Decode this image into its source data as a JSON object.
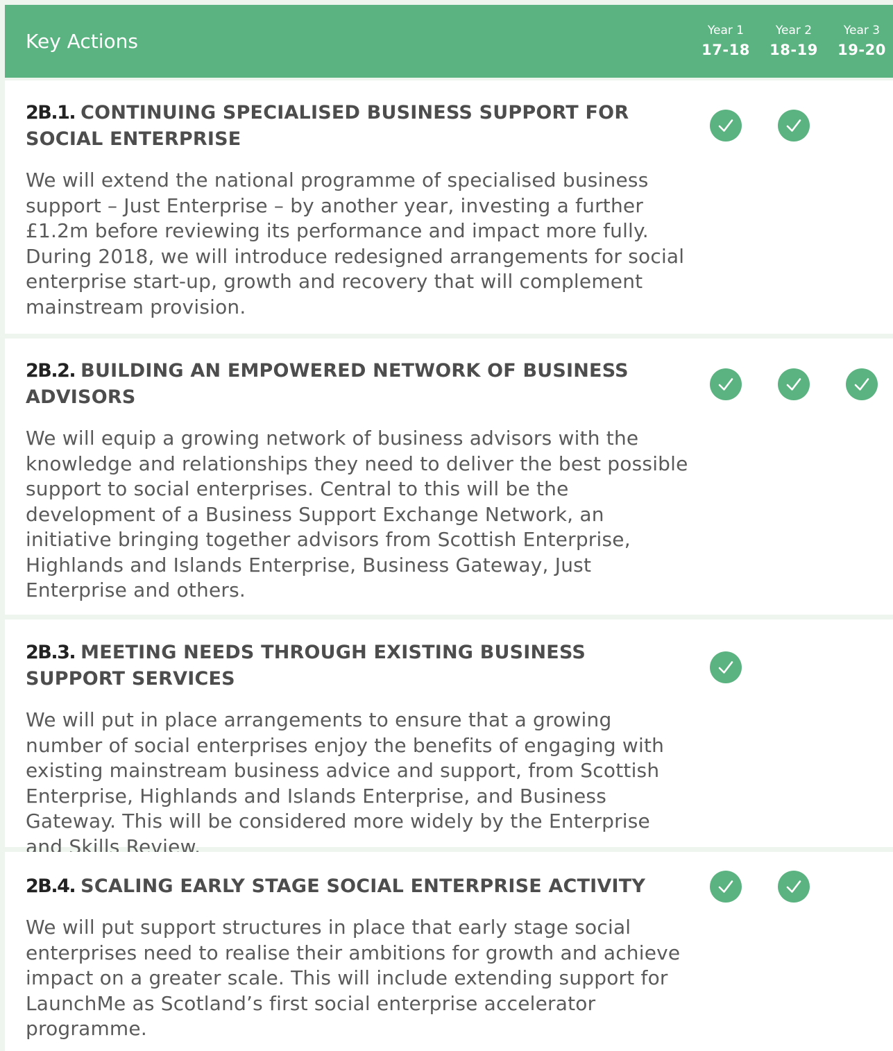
{
  "header": {
    "title": "Key Actions",
    "years": [
      {
        "label": "Year 1",
        "range": "17-18"
      },
      {
        "label": "Year 2",
        "range": "18-19"
      },
      {
        "label": "Year 3",
        "range": "19-20"
      }
    ]
  },
  "actions": [
    {
      "code": "2B.1.",
      "title": "CONTINUING SPECIALISED BUSINESS SUPPORT FOR SOCIAL ENTERPRISE",
      "description": "We will extend the national programme of specialised business support – Just Enterprise – by another year, investing a further £1.2m before reviewing its performance and impact more fully. During 2018, we will introduce redesigned arrangements for social enterprise start-up, growth and recovery that will complement mainstream provision.",
      "checks": [
        true,
        true,
        false
      ]
    },
    {
      "code": "2B.2.",
      "title": "BUILDING AN EMPOWERED NETWORK OF BUSINESS ADVISORS",
      "description": "We will equip a growing network of business advisors with the knowledge and relationships they need to deliver the best possible support to social enterprises. Central to this will be the development of a Business Support Exchange Network, an initiative bringing together advisors from Scottish Enterprise, Highlands and Islands Enterprise, Business Gateway, Just Enterprise and others.",
      "checks": [
        true,
        true,
        true
      ]
    },
    {
      "code": "2B.3.",
      "title": "MEETING NEEDS THROUGH EXISTING BUSINESS SUPPORT SERVICES",
      "description": "We will put in place arrangements to ensure that a growing number of social enterprises enjoy the benefits of engaging with existing mainstream business advice and support, from Scottish Enterprise, Highlands and Islands Enterprise, and Business Gateway. This will be considered more widely by the Enterprise and Skills Review.",
      "checks": [
        true,
        false,
        false
      ]
    },
    {
      "code": "2B.4.",
      "title": "SCALING EARLY STAGE SOCIAL ENTERPRISE ACTIVITY",
      "description": "We will put support structures in place that early stage social enterprises need to realise their ambitions for growth and achieve impact on a greater scale. This will include extending support for LaunchMe as Scotland’s first social enterprise accelerator programme.",
      "checks": [
        true,
        true,
        false
      ]
    }
  ],
  "colors": {
    "accent": "#5bb381",
    "divider": "#eef4ee",
    "code_text": "#222222",
    "body_text": "#5a5a5a"
  },
  "icons": {
    "check": "check-circle-icon"
  }
}
